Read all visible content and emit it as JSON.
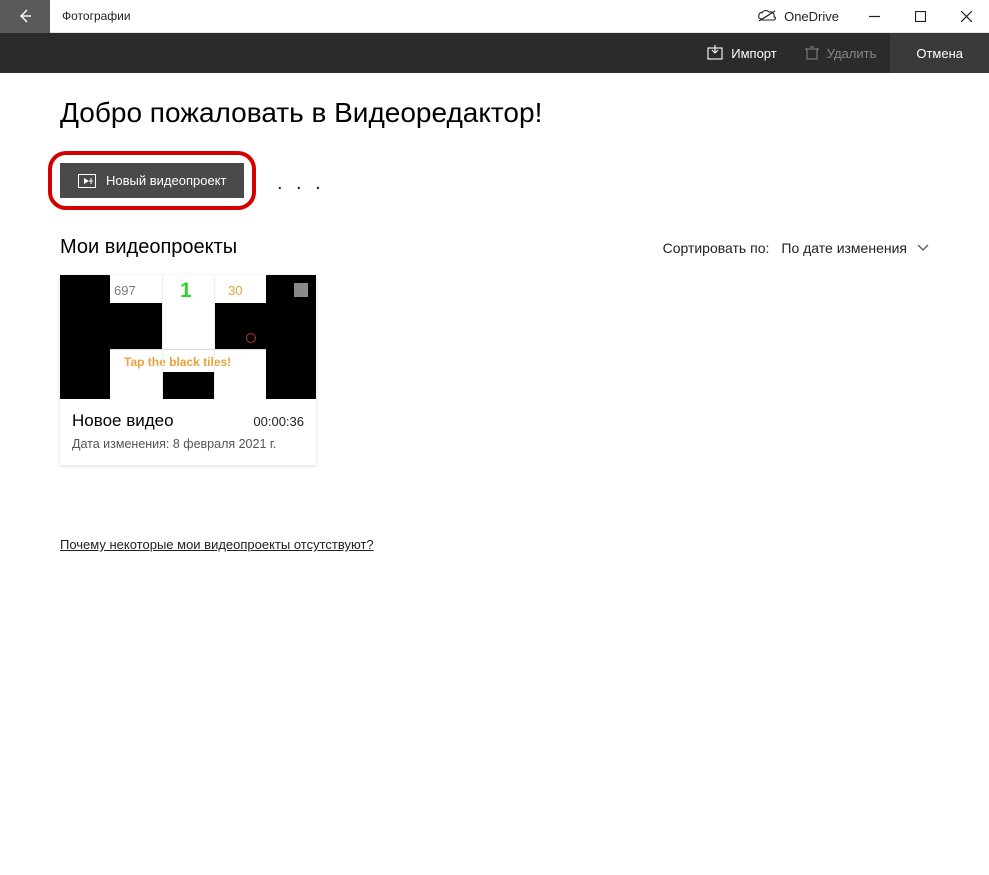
{
  "titlebar": {
    "app_title": "Фотографии",
    "onedrive_label": "OneDrive"
  },
  "toolbar": {
    "import_label": "Импорт",
    "delete_label": "Удалить",
    "cancel_label": "Отмена"
  },
  "main": {
    "welcome": "Добро пожаловать в Видеоредактор!",
    "new_project_label": "Новый видеопроект",
    "more_dots": ". . .",
    "projects_title": "Мои видеопроекты",
    "sort_label": "Сортировать по:",
    "sort_value": "По дате изменения",
    "why_link": "Почему некоторые мои видеопроекты отсутствуют?"
  },
  "project": {
    "title": "Новое видео",
    "duration": "00:00:36",
    "modified_label": "Дата изменения: 8 февраля 2021 г.",
    "thumb_text": {
      "t697": "697",
      "t1": "1",
      "t30": "30",
      "tap": "Tap the black tiles!"
    }
  }
}
